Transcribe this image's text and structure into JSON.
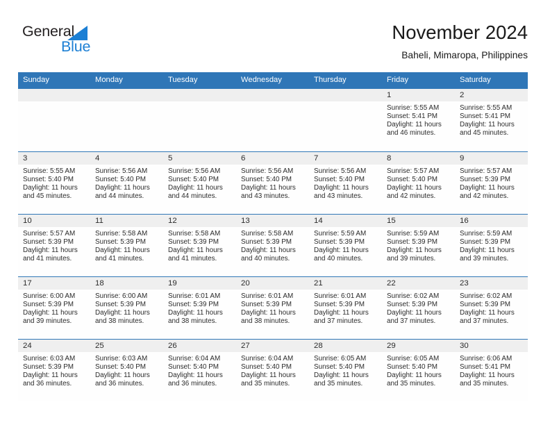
{
  "brand": {
    "name_part1": "General",
    "name_part2": "Blue",
    "triangle_icon": "blue-triangle-icon",
    "accent_color": "#1c7fd4"
  },
  "header": {
    "title": "November 2024",
    "subtitle": "Baheli, Mimaropa, Philippines"
  },
  "colors": {
    "header_blue": "#2f76b7",
    "daynum_band": "#efefef",
    "text": "#2b2b2b"
  },
  "weekday_headers": [
    "Sunday",
    "Monday",
    "Tuesday",
    "Wednesday",
    "Thursday",
    "Friday",
    "Saturday"
  ],
  "labels": {
    "sunrise": "Sunrise:",
    "sunset": "Sunset:",
    "daylight": "Daylight:"
  },
  "weeks": [
    [
      {
        "day": "",
        "blank": true
      },
      {
        "day": "",
        "blank": true
      },
      {
        "day": "",
        "blank": true
      },
      {
        "day": "",
        "blank": true
      },
      {
        "day": "",
        "blank": true
      },
      {
        "day": "1",
        "sunrise": "Sunrise: 5:55 AM",
        "sunset": "Sunset: 5:41 PM",
        "daylight_line1": "Daylight: 11 hours",
        "daylight_line2": "and 46 minutes."
      },
      {
        "day": "2",
        "sunrise": "Sunrise: 5:55 AM",
        "sunset": "Sunset: 5:41 PM",
        "daylight_line1": "Daylight: 11 hours",
        "daylight_line2": "and 45 minutes."
      }
    ],
    [
      {
        "day": "3",
        "sunrise": "Sunrise: 5:55 AM",
        "sunset": "Sunset: 5:40 PM",
        "daylight_line1": "Daylight: 11 hours",
        "daylight_line2": "and 45 minutes."
      },
      {
        "day": "4",
        "sunrise": "Sunrise: 5:56 AM",
        "sunset": "Sunset: 5:40 PM",
        "daylight_line1": "Daylight: 11 hours",
        "daylight_line2": "and 44 minutes."
      },
      {
        "day": "5",
        "sunrise": "Sunrise: 5:56 AM",
        "sunset": "Sunset: 5:40 PM",
        "daylight_line1": "Daylight: 11 hours",
        "daylight_line2": "and 44 minutes."
      },
      {
        "day": "6",
        "sunrise": "Sunrise: 5:56 AM",
        "sunset": "Sunset: 5:40 PM",
        "daylight_line1": "Daylight: 11 hours",
        "daylight_line2": "and 43 minutes."
      },
      {
        "day": "7",
        "sunrise": "Sunrise: 5:56 AM",
        "sunset": "Sunset: 5:40 PM",
        "daylight_line1": "Daylight: 11 hours",
        "daylight_line2": "and 43 minutes."
      },
      {
        "day": "8",
        "sunrise": "Sunrise: 5:57 AM",
        "sunset": "Sunset: 5:40 PM",
        "daylight_line1": "Daylight: 11 hours",
        "daylight_line2": "and 42 minutes."
      },
      {
        "day": "9",
        "sunrise": "Sunrise: 5:57 AM",
        "sunset": "Sunset: 5:39 PM",
        "daylight_line1": "Daylight: 11 hours",
        "daylight_line2": "and 42 minutes."
      }
    ],
    [
      {
        "day": "10",
        "sunrise": "Sunrise: 5:57 AM",
        "sunset": "Sunset: 5:39 PM",
        "daylight_line1": "Daylight: 11 hours",
        "daylight_line2": "and 41 minutes."
      },
      {
        "day": "11",
        "sunrise": "Sunrise: 5:58 AM",
        "sunset": "Sunset: 5:39 PM",
        "daylight_line1": "Daylight: 11 hours",
        "daylight_line2": "and 41 minutes."
      },
      {
        "day": "12",
        "sunrise": "Sunrise: 5:58 AM",
        "sunset": "Sunset: 5:39 PM",
        "daylight_line1": "Daylight: 11 hours",
        "daylight_line2": "and 41 minutes."
      },
      {
        "day": "13",
        "sunrise": "Sunrise: 5:58 AM",
        "sunset": "Sunset: 5:39 PM",
        "daylight_line1": "Daylight: 11 hours",
        "daylight_line2": "and 40 minutes."
      },
      {
        "day": "14",
        "sunrise": "Sunrise: 5:59 AM",
        "sunset": "Sunset: 5:39 PM",
        "daylight_line1": "Daylight: 11 hours",
        "daylight_line2": "and 40 minutes."
      },
      {
        "day": "15",
        "sunrise": "Sunrise: 5:59 AM",
        "sunset": "Sunset: 5:39 PM",
        "daylight_line1": "Daylight: 11 hours",
        "daylight_line2": "and 39 minutes."
      },
      {
        "day": "16",
        "sunrise": "Sunrise: 5:59 AM",
        "sunset": "Sunset: 5:39 PM",
        "daylight_line1": "Daylight: 11 hours",
        "daylight_line2": "and 39 minutes."
      }
    ],
    [
      {
        "day": "17",
        "sunrise": "Sunrise: 6:00 AM",
        "sunset": "Sunset: 5:39 PM",
        "daylight_line1": "Daylight: 11 hours",
        "daylight_line2": "and 39 minutes."
      },
      {
        "day": "18",
        "sunrise": "Sunrise: 6:00 AM",
        "sunset": "Sunset: 5:39 PM",
        "daylight_line1": "Daylight: 11 hours",
        "daylight_line2": "and 38 minutes."
      },
      {
        "day": "19",
        "sunrise": "Sunrise: 6:01 AM",
        "sunset": "Sunset: 5:39 PM",
        "daylight_line1": "Daylight: 11 hours",
        "daylight_line2": "and 38 minutes."
      },
      {
        "day": "20",
        "sunrise": "Sunrise: 6:01 AM",
        "sunset": "Sunset: 5:39 PM",
        "daylight_line1": "Daylight: 11 hours",
        "daylight_line2": "and 38 minutes."
      },
      {
        "day": "21",
        "sunrise": "Sunrise: 6:01 AM",
        "sunset": "Sunset: 5:39 PM",
        "daylight_line1": "Daylight: 11 hours",
        "daylight_line2": "and 37 minutes."
      },
      {
        "day": "22",
        "sunrise": "Sunrise: 6:02 AM",
        "sunset": "Sunset: 5:39 PM",
        "daylight_line1": "Daylight: 11 hours",
        "daylight_line2": "and 37 minutes."
      },
      {
        "day": "23",
        "sunrise": "Sunrise: 6:02 AM",
        "sunset": "Sunset: 5:39 PM",
        "daylight_line1": "Daylight: 11 hours",
        "daylight_line2": "and 37 minutes."
      }
    ],
    [
      {
        "day": "24",
        "sunrise": "Sunrise: 6:03 AM",
        "sunset": "Sunset: 5:39 PM",
        "daylight_line1": "Daylight: 11 hours",
        "daylight_line2": "and 36 minutes."
      },
      {
        "day": "25",
        "sunrise": "Sunrise: 6:03 AM",
        "sunset": "Sunset: 5:40 PM",
        "daylight_line1": "Daylight: 11 hours",
        "daylight_line2": "and 36 minutes."
      },
      {
        "day": "26",
        "sunrise": "Sunrise: 6:04 AM",
        "sunset": "Sunset: 5:40 PM",
        "daylight_line1": "Daylight: 11 hours",
        "daylight_line2": "and 36 minutes."
      },
      {
        "day": "27",
        "sunrise": "Sunrise: 6:04 AM",
        "sunset": "Sunset: 5:40 PM",
        "daylight_line1": "Daylight: 11 hours",
        "daylight_line2": "and 35 minutes."
      },
      {
        "day": "28",
        "sunrise": "Sunrise: 6:05 AM",
        "sunset": "Sunset: 5:40 PM",
        "daylight_line1": "Daylight: 11 hours",
        "daylight_line2": "and 35 minutes."
      },
      {
        "day": "29",
        "sunrise": "Sunrise: 6:05 AM",
        "sunset": "Sunset: 5:40 PM",
        "daylight_line1": "Daylight: 11 hours",
        "daylight_line2": "and 35 minutes."
      },
      {
        "day": "30",
        "sunrise": "Sunrise: 6:06 AM",
        "sunset": "Sunset: 5:41 PM",
        "daylight_line1": "Daylight: 11 hours",
        "daylight_line2": "and 35 minutes."
      }
    ]
  ]
}
